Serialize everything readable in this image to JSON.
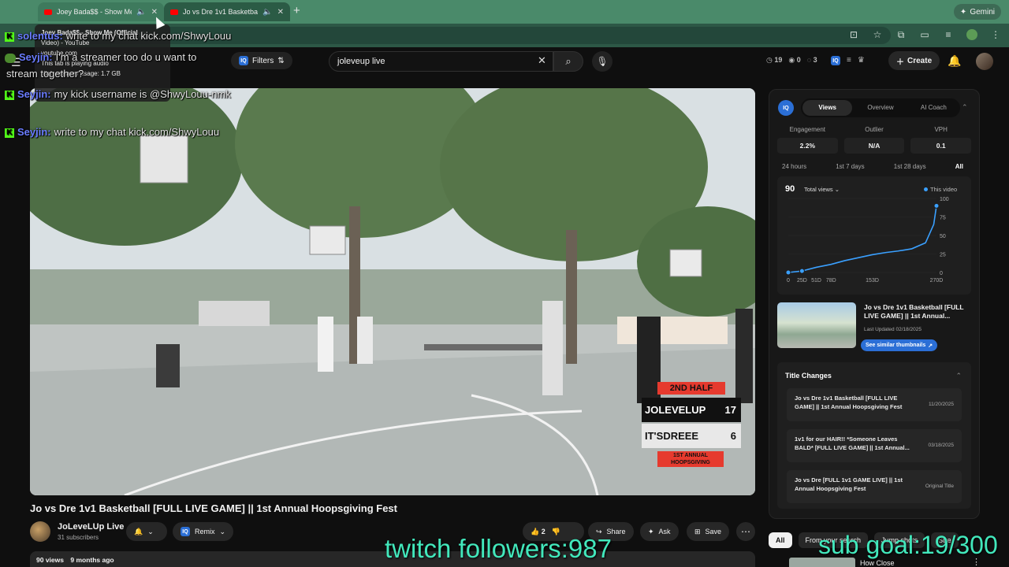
{
  "browser": {
    "tabs": [
      {
        "title": "Joey Bada$$ - Show Me",
        "active": false
      },
      {
        "title": "Jo vs Dre 1v1 Basketball [",
        "active": true
      }
    ],
    "new_tab": "+",
    "gemini": "Gemini",
    "url": "youtube.com/watch?v=…",
    "tab_tooltip": {
      "title": "Joey Bada$$ - Show Me (Official",
      "subtitle": "Video) - YouTube",
      "domain": "youtube.com",
      "audio": "This tab is playing audio",
      "memory": "High memory usage: 1.7 GB"
    }
  },
  "masthead": {
    "filters_label": "Filters",
    "search_query": "joleveup live",
    "stats": {
      "a": "19",
      "b": "0",
      "c": "3"
    },
    "create_label": "Create"
  },
  "video": {
    "scoreboard": {
      "half": "2ND HALF",
      "team1": "JOLEVELUP",
      "score1": "17",
      "team2": "IT'SDREEE",
      "score2": "6",
      "event": "1ST ANNUAL HOOPSGIVING"
    },
    "title": "Jo vs Dre 1v1 Basketball [FULL LIVE GAME] || 1st Annual Hoopsgiving Fest",
    "channel": "JoLeveLUp Live",
    "subscribers": "31 subscribers",
    "remix_label": "Remix",
    "likes": "2",
    "share_label": "Share",
    "ask_label": "Ask",
    "save_label": "Save",
    "views": "90 views",
    "age": "9 months ago"
  },
  "panel": {
    "tabs": [
      "Views",
      "Overview",
      "AI Coach"
    ],
    "active_tab": "Views",
    "metrics": [
      {
        "label": "Engagement",
        "value": "2.2%"
      },
      {
        "label": "Outlier",
        "value": "N/A"
      },
      {
        "label": "VPH",
        "value": "0.1"
      }
    ],
    "ranges": [
      "24 hours",
      "1st 7 days",
      "1st 28 days",
      "All"
    ],
    "active_range": "All",
    "total": "90",
    "total_select": "Total views",
    "legend": "This video",
    "thumb_title": "Jo vs Dre 1v1 Basketball [FULL LIVE GAME] || 1st Annual...",
    "last_updated": "Last Updated 02/18/2025",
    "similar_btn": "See similar thumbnails",
    "title_changes_label": "Title Changes",
    "title_changes": [
      {
        "title": "Jo vs Dre 1v1 Basketball [FULL LIVE GAME] || 1st Annual Hoopsgiving Fest",
        "date": "11/20/2025"
      },
      {
        "title": "1v1 for our HAIR!! *Someone Leaves BALD* [FULL LIVE GAME] || 1st Annual...",
        "date": "03/18/2025"
      },
      {
        "title": "Jo vs Dre [FULL 1v1 GAME LIVE] || 1st Annual Hoopsgiving Fest",
        "date": "Original Title"
      }
    ]
  },
  "chart_data": {
    "type": "line",
    "x": [
      0,
      25,
      51,
      78,
      103,
      128,
      153,
      178,
      200,
      225,
      250,
      265,
      270
    ],
    "series": [
      {
        "values": [
          0,
          2,
          7,
          11,
          16,
          20,
          24,
          27,
          29,
          32,
          40,
          65,
          90
        ]
      }
    ],
    "x_tick_labels": [
      "0",
      "25D",
      "51D",
      "78D",
      "153D",
      "270D"
    ],
    "x_ticks": [
      0,
      25,
      51,
      78,
      153,
      270
    ],
    "y_ticks": [
      0,
      25,
      50,
      75,
      100
    ],
    "ylim": [
      0,
      100
    ],
    "xlim": [
      0,
      270
    ],
    "line_color": "#3aa0ff"
  },
  "chips": [
    "All",
    "From your search",
    "Jump shots",
    "Stre"
  ],
  "recommendation": {
    "title": "How Close"
  },
  "overlay": {
    "chat": [
      {
        "user": "solentus:",
        "text": "write to my chat kick.com/ShwyLouu"
      },
      {
        "user": "Seyjin:",
        "text": "I'm a streamer too do u want to"
      },
      {
        "user": "",
        "text": "stream together?"
      },
      {
        "user": "Seyjin:",
        "text": "my kick username is @ShwyLouu-nmk"
      },
      {
        "user": "Seyjin:",
        "text": "write to my chat kick.com/ShwyLouu"
      }
    ],
    "twitch_followers": "twitch followers:987",
    "sub_goal": "sub goal:19/300"
  },
  "colors": {
    "accent": "#2b6fd6",
    "overlay_text": "#42e8bc",
    "tab_bar": "#4a8a6a"
  }
}
